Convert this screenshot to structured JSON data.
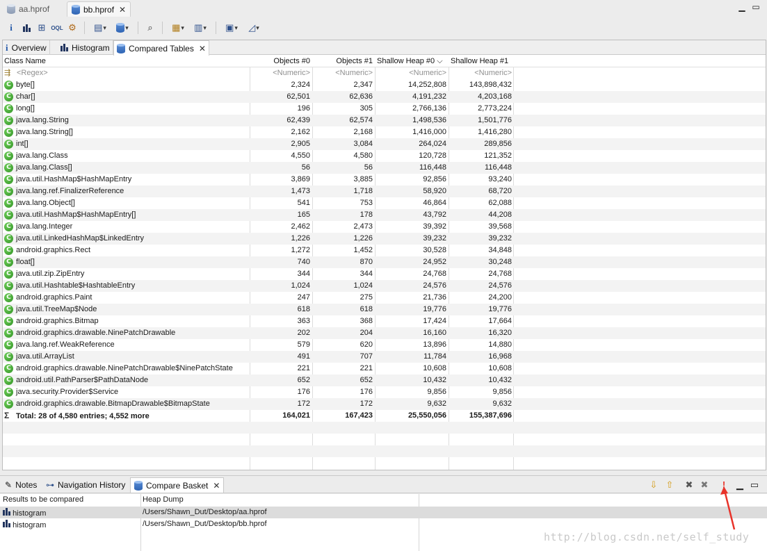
{
  "editor_tabs": [
    {
      "label": "aa.hprof",
      "active": false
    },
    {
      "label": "bb.hprof",
      "active": true
    }
  ],
  "toolbar_icons": [
    "info-icon",
    "histogram-icon",
    "dominator-tree-icon",
    "oql-icon",
    "heap-dump-details-icon",
    "run-expert-system-icon",
    "query-browser-icon",
    "search-icon",
    "group-icon",
    "calculate-retained-size-icon",
    "export-icon",
    "compare-icon"
  ],
  "view_tabs": [
    {
      "label": "Overview",
      "icon": "info-icon"
    },
    {
      "label": "Histogram",
      "icon": "histogram-icon"
    },
    {
      "label": "Compared Tables",
      "icon": "compare-tables-icon",
      "active": true
    }
  ],
  "table": {
    "columns": [
      "Class Name",
      "Objects #0",
      "Objects #1",
      "Shallow Heap #0",
      "Shallow Heap #1"
    ],
    "sort_indicator": "⌵",
    "filter_row": {
      "name": "<Regex>",
      "num": "<Numeric>"
    },
    "rows": [
      [
        "byte[]",
        "2,324",
        "2,347",
        "14,252,808",
        "143,898,432"
      ],
      [
        "char[]",
        "62,501",
        "62,636",
        "4,191,232",
        "4,203,168"
      ],
      [
        "long[]",
        "196",
        "305",
        "2,766,136",
        "2,773,224"
      ],
      [
        "java.lang.String",
        "62,439",
        "62,574",
        "1,498,536",
        "1,501,776"
      ],
      [
        "java.lang.String[]",
        "2,162",
        "2,168",
        "1,416,000",
        "1,416,280"
      ],
      [
        "int[]",
        "2,905",
        "3,084",
        "264,024",
        "289,856"
      ],
      [
        "java.lang.Class",
        "4,550",
        "4,580",
        "120,728",
        "121,352"
      ],
      [
        "java.lang.Class[]",
        "56",
        "56",
        "116,448",
        "116,448"
      ],
      [
        "java.util.HashMap$HashMapEntry",
        "3,869",
        "3,885",
        "92,856",
        "93,240"
      ],
      [
        "java.lang.ref.FinalizerReference",
        "1,473",
        "1,718",
        "58,920",
        "68,720"
      ],
      [
        "java.lang.Object[]",
        "541",
        "753",
        "46,864",
        "62,088"
      ],
      [
        "java.util.HashMap$HashMapEntry[]",
        "165",
        "178",
        "43,792",
        "44,208"
      ],
      [
        "java.lang.Integer",
        "2,462",
        "2,473",
        "39,392",
        "39,568"
      ],
      [
        "java.util.LinkedHashMap$LinkedEntry",
        "1,226",
        "1,226",
        "39,232",
        "39,232"
      ],
      [
        "android.graphics.Rect",
        "1,272",
        "1,452",
        "30,528",
        "34,848"
      ],
      [
        "float[]",
        "740",
        "870",
        "24,952",
        "30,248"
      ],
      [
        "java.util.zip.ZipEntry",
        "344",
        "344",
        "24,768",
        "24,768"
      ],
      [
        "java.util.Hashtable$HashtableEntry",
        "1,024",
        "1,024",
        "24,576",
        "24,576"
      ],
      [
        "android.graphics.Paint",
        "247",
        "275",
        "21,736",
        "24,200"
      ],
      [
        "java.util.TreeMap$Node",
        "618",
        "618",
        "19,776",
        "19,776"
      ],
      [
        "android.graphics.Bitmap",
        "363",
        "368",
        "17,424",
        "17,664"
      ],
      [
        "android.graphics.drawable.NinePatchDrawable",
        "202",
        "204",
        "16,160",
        "16,320"
      ],
      [
        "java.lang.ref.WeakReference",
        "579",
        "620",
        "13,896",
        "14,880"
      ],
      [
        "java.util.ArrayList",
        "491",
        "707",
        "11,784",
        "16,968"
      ],
      [
        "android.graphics.drawable.NinePatchDrawable$NinePatchState",
        "221",
        "221",
        "10,608",
        "10,608"
      ],
      [
        "android.util.PathParser$PathDataNode",
        "652",
        "652",
        "10,432",
        "10,432"
      ],
      [
        "java.security.Provider$Service",
        "176",
        "176",
        "9,856",
        "9,856"
      ],
      [
        "android.graphics.drawable.BitmapDrawable$BitmapState",
        "172",
        "172",
        "9,632",
        "9,632"
      ]
    ],
    "total": [
      "Total: 28 of 4,580 entries; 4,552 more",
      "164,021",
      "167,423",
      "25,550,056",
      "155,387,696"
    ]
  },
  "bottom_tabs": [
    {
      "label": "Notes"
    },
    {
      "label": "Navigation History"
    },
    {
      "label": "Compare Basket",
      "active": true
    }
  ],
  "basket": {
    "columns": [
      "Results to be compared",
      "Heap Dump"
    ],
    "rows": [
      {
        "result": "histogram",
        "dump": "/Users/Shawn_Dut/Desktop/aa.hprof"
      },
      {
        "result": "histogram",
        "dump": "/Users/Shawn_Dut/Desktop/bb.hprof"
      }
    ]
  },
  "watermark": "http://blog.csdn.net/self_study",
  "colors": {
    "accent_red": "#e8332a",
    "class_icon_green": "#3aa52c",
    "selection": "#dcdcdc"
  }
}
